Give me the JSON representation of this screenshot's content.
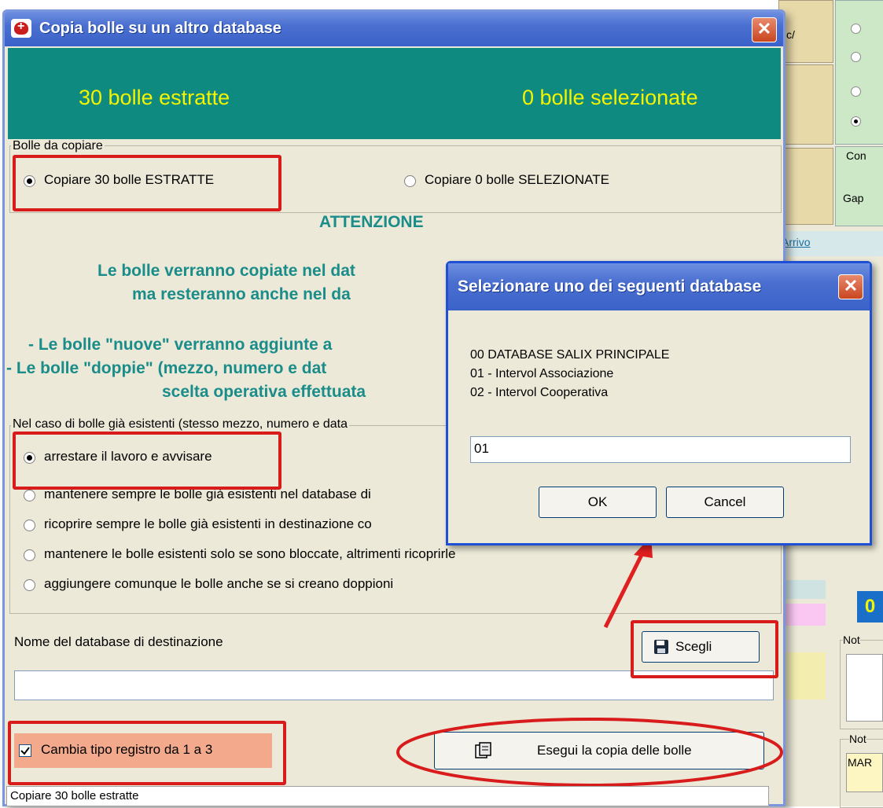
{
  "main_dialog": {
    "title": "Copia bolle su un altro database",
    "close_glyph": "✕",
    "header": {
      "extracted": "30 bolle estratte",
      "selected": "0 bolle selezionate"
    },
    "group_copy": {
      "label": "Bolle da copiare",
      "options": [
        "Copiare 30 bolle ESTRATTE",
        "Copiare 0 bolle SELEZIONATE"
      ],
      "selected_index": 0
    },
    "warning": {
      "title": "ATTENZIONE",
      "lines": [
        "Le bolle verranno copiate nel dat",
        "ma resteranno anche nel da",
        "- Le bolle \"nuove\" verranno aggiunte a",
        "- Le bolle \"doppie\" (mezzo, numero e dat",
        "scelta operativa effettuata"
      ]
    },
    "group_existing": {
      "label": "Nel caso di bolle già esistenti (stesso mezzo, numero e data",
      "options": [
        "arrestare il lavoro e avvisare",
        "mantenere sempre le bolle già esistenti nel database di",
        "ricoprire sempre le bolle già esistenti in destinazione co",
        "mantenere le bolle esistenti solo se sono bloccate, altrimenti ricoprirle",
        "aggiungere comunque le bolle anche se si creano doppioni"
      ],
      "selected_index": 0
    },
    "destination": {
      "label": "Nome del database di destinazione",
      "value": ""
    },
    "choose_button": "Scegli",
    "checkbox": {
      "label": "Cambia tipo registro da 1 a 3",
      "checked": true
    },
    "execute_button": "Esegui la copia delle bolle",
    "status": "Copiare 30 bolle estratte"
  },
  "select_dialog": {
    "title": "Selezionare uno dei seguenti database",
    "options": [
      "00 DATABASE SALIX PRINCIPALE",
      "01 - Intervol Associazione",
      "02 - Intervol Cooperativa"
    ],
    "input_value": "01",
    "ok": "OK",
    "cancel": "Cancel"
  },
  "background_app": {
    "labels": [
      "c/",
      "Con",
      "Gap",
      "Arrivo",
      "Not",
      "Not",
      "MAR",
      "0"
    ]
  },
  "colors": {
    "banner": "#0e8a80",
    "banner_text": "#f4f400",
    "highlight": "#d81c1c",
    "attention": "#1a8c8a"
  }
}
